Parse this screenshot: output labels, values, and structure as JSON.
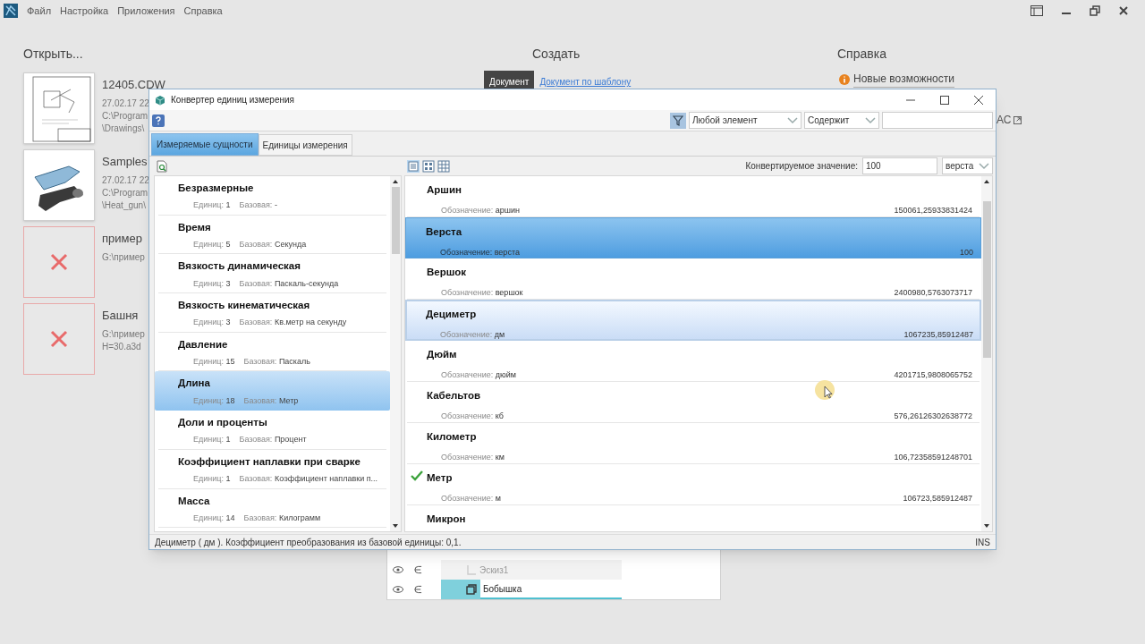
{
  "menu": [
    "Файл",
    "Настройка",
    "Приложения",
    "Справка"
  ],
  "open": {
    "title": "Открыть...",
    "files": [
      {
        "kind": "drawing",
        "name": "12405.CDW",
        "lines": [
          "27.02.17 22",
          "C:\\Program",
          "\\Drawings\\"
        ]
      },
      {
        "kind": "model",
        "name": "Samples",
        "lines": [
          "27.02.17 22",
          "C:\\Program",
          "\\Heat_gun\\"
        ]
      },
      {
        "kind": "missing",
        "name": "пример",
        "lines": [
          "G:\\пример"
        ]
      },
      {
        "kind": "missing",
        "name": "Башня",
        "lines": [
          "G:\\пример",
          "H=30.a3d"
        ]
      }
    ]
  },
  "create": {
    "title": "Создать",
    "buttons": [
      {
        "label": "Документ",
        "selected": true
      },
      {
        "label": "Документ по шаблону",
        "selected": false
      }
    ]
  },
  "help": {
    "title": "Справка",
    "link": "Новые возможности",
    "cut_link": "АС"
  },
  "tree": [
    {
      "label": "Эскиз1",
      "kind": "item",
      "disabled": true
    },
    {
      "label": "Бобышка",
      "kind": "edit",
      "disabled": false
    }
  ],
  "dialog": {
    "title": "Конвертер единиц измерения",
    "filter_element": "Любой элемент",
    "filter_condition": "Содержит",
    "tabs": [
      {
        "label": "Измеряемые сущности",
        "selected": true
      },
      {
        "label": "Единицы измерения",
        "selected": false
      }
    ],
    "entities": [
      {
        "name": "Безразмерные",
        "units_label": "Единиц:",
        "units": "1",
        "base_label": "Базовая:",
        "base": "-",
        "selected": false
      },
      {
        "name": "Время",
        "units_label": "Единиц:",
        "units": "5",
        "base_label": "Базовая:",
        "base": "Секунда",
        "selected": false
      },
      {
        "name": "Вязкость динамическая",
        "units_label": "Единиц:",
        "units": "3",
        "base_label": "Базовая:",
        "base": "Паскаль-секунда",
        "selected": false
      },
      {
        "name": "Вязкость кинематическая",
        "units_label": "Единиц:",
        "units": "3",
        "base_label": "Базовая:",
        "base": "Кв.метр на секунду",
        "selected": false
      },
      {
        "name": "Давление",
        "units_label": "Единиц:",
        "units": "15",
        "base_label": "Базовая:",
        "base": "Паскаль",
        "selected": false
      },
      {
        "name": "Длина",
        "units_label": "Единиц:",
        "units": "18",
        "base_label": "Базовая:",
        "base": "Метр",
        "selected": true
      },
      {
        "name": "Доли и проценты",
        "units_label": "Единиц:",
        "units": "1",
        "base_label": "Базовая:",
        "base": "Процент",
        "selected": false
      },
      {
        "name": "Коэффициент наплавки при сварке",
        "units_label": "Единиц:",
        "units": "1",
        "base_label": "Базовая:",
        "base": "Коэффициент наплавки п...",
        "selected": false
      },
      {
        "name": "Масса",
        "units_label": "Единиц:",
        "units": "14",
        "base_label": "Базовая:",
        "base": "Килограмм",
        "selected": false
      }
    ],
    "convert_label": "Конвертируемое значение:",
    "convert_value": "100",
    "convert_unit": "верста",
    "units": [
      {
        "name": "Аршин",
        "symbol_label": "Обозначение:",
        "symbol": "аршин",
        "value": "150061,25933831424",
        "selected": false,
        "hovered": false,
        "base": false
      },
      {
        "name": "Верста",
        "symbol_label": "Обозначение:",
        "symbol": "верста",
        "value": "100",
        "selected": true,
        "hovered": false,
        "base": false
      },
      {
        "name": "Вершок",
        "symbol_label": "Обозначение:",
        "symbol": "вершок",
        "value": "2400980,5763073717",
        "selected": false,
        "hovered": false,
        "base": false
      },
      {
        "name": "Дециметр",
        "symbol_label": "Обозначение:",
        "symbol": "дм",
        "value": "1067235,85912487",
        "selected": false,
        "hovered": true,
        "base": false
      },
      {
        "name": "Дюйм",
        "symbol_label": "Обозначение:",
        "symbol": "дюйм",
        "value": "4201715,9808065752",
        "selected": false,
        "hovered": false,
        "base": false
      },
      {
        "name": "Кабельтов",
        "symbol_label": "Обозначение:",
        "symbol": "кб",
        "value": "576,26126302638772",
        "selected": false,
        "hovered": false,
        "base": false
      },
      {
        "name": "Километр",
        "symbol_label": "Обозначение:",
        "symbol": "км",
        "value": "106,72358591248701",
        "selected": false,
        "hovered": false,
        "base": false
      },
      {
        "name": "Метр",
        "symbol_label": "Обозначение:",
        "symbol": "м",
        "value": "106723,585912487",
        "selected": false,
        "hovered": false,
        "base": true
      },
      {
        "name": "Микрон",
        "selected": false,
        "hovered": false,
        "base": false
      }
    ],
    "status": "Дециметр ( дм ). Коэффициент преобразования из базовой единицы: 0,1.",
    "mode": "INS"
  }
}
